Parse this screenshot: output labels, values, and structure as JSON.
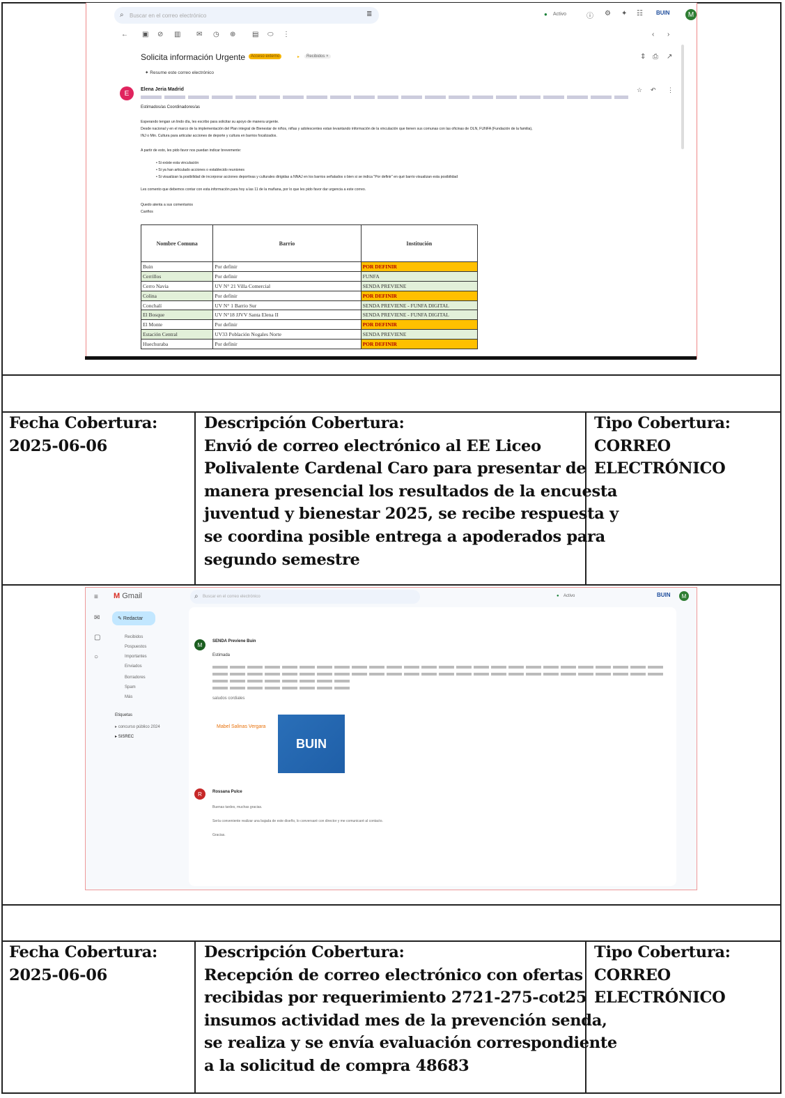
{
  "rows": [
    {
      "fecha_label": "Fecha Cobertura:",
      "fecha_value": "2025-06-06",
      "descripcion_label": "Descripción Cobertura:",
      "descripcion_lines": [
        "Envió de correo electrónico al EE Liceo",
        "Polivalente Cardenal Caro para presentar de",
        "manera presencial los resultados de la encuesta",
        "juventud y bienestar 2025, se recibe respuesta y",
        "se coordina posible entrega a apoderados para",
        "segundo semestre"
      ],
      "tipo_label": "Tipo Cobertura:",
      "tipo_lines": [
        "CORREO",
        "ELECTRÓNICO"
      ]
    },
    {
      "fecha_label": "Fecha Cobertura:",
      "fecha_value": "2025-06-06",
      "descripcion_label": "Descripción Cobertura:",
      "descripcion_lines": [
        "Recepción de correo electrónico con ofertas",
        "recibidas por requerimiento 2721-275-cot25",
        "insumos actividad mes de la prevención senda,",
        "se realiza y se envía evaluación correspondiente",
        "a la solicitud de compra 48683"
      ],
      "tipo_label": "Tipo Cobertura:",
      "tipo_lines": [
        "CORREO",
        "ELECTRÓNICO"
      ]
    }
  ],
  "screenshot1": {
    "search_placeholder": "Buscar en el correo electrónico",
    "status": "Activo",
    "brand": "BUIN",
    "avatar_letter": "M",
    "subject": "Solicita información Urgente",
    "label_badge": "Acceso externo",
    "label_inbox": "Recibidos ×",
    "summarize": "Resume este correo electrónico",
    "sender": "Elena Jeria Madrid",
    "sender_avatar": "E",
    "greeting": "Estimados/as Coordinadores/as",
    "body_lines": [
      "Esperando tengan un lindo día, les escribo para solicitar su apoyo de manera urgente.",
      "Desde nacional y en el marco de la implementación del Plan integral de Bienestar de niños, niñas y adolescentes estan levantando información de la vinculación que tienen sus comunas con las oficinas de OLN, FUNFA (Fundación de la familia),",
      "INJ o Min. Cultura para articular acciones de deporte y cultura en barrios focalizados."
    ],
    "intro_list": "A partir de esto, les pido favor nos puedan indicar brevemente:",
    "bullets": [
      "Si existe esta vinculación",
      "Si ya han articulado acciones o establecido reuniones",
      "Si visualizan la posibilidad de incorporar acciones deportivas y culturales dirigidas a NNAJ en los barrios señalados o bien si se indica \"Por definir\" en qué barrio visualizan esta posibilidad"
    ],
    "deadline": "Les comento que debemos contar con esta información para hoy a las 11 de la mañana, por lo que les pido favor dar urgencia a este correo.",
    "closing": "Quedo atenta a sus comentarios",
    "signoff": "Cariños",
    "table": {
      "headers": [
        "Nombre Comuna",
        "Barrio",
        "Institución"
      ],
      "rows": [
        [
          "Buin",
          "Por definir",
          "POR DEFINIR"
        ],
        [
          "Cerrillos",
          "Por definir",
          "FUNFA"
        ],
        [
          "Cerro Navia",
          "UV N° 21 Villa Comercial",
          "SENDA PREVIENE"
        ],
        [
          "Colina",
          "Por definir",
          "POR DEFINIR"
        ],
        [
          "Conchalí",
          "UV N° 1 Barrio Sur",
          "SENDA PREVIENE - FUNFA DIGITAL"
        ],
        [
          "El Bosque",
          "UV N°18 JJVV Santa Elena II",
          "SENDA PREVIENE - FUNFA DIGITAL"
        ],
        [
          "El Monte",
          "Por definir",
          "POR DEFINIR"
        ],
        [
          "Estación Central",
          "UV33 Población Nogales Norte",
          "SENDA PREVIENE"
        ],
        [
          "Huechuraba",
          "Por definir",
          "POR DEFINIR"
        ]
      ]
    }
  },
  "screenshot2": {
    "app_name": "Gmail",
    "compose": "Redactar",
    "search_placeholder": "Buscar en el correo electrónico",
    "status": "Activo",
    "brand": "BUIN",
    "avatar_letter": "M",
    "nav_items": [
      "Recibidos",
      "Pospuestos",
      "Importantes",
      "Enviados",
      "Borradores",
      "Spam",
      "Más"
    ],
    "labels_title": "Etiquetas",
    "labels": [
      "concurso público 2024",
      "SISREC"
    ],
    "sender1": "SENDA Previene Buin",
    "sender1_avatar": "M",
    "greeting1": "Estimada",
    "signature_name": "Mabel Salinas Vergara",
    "salutation": "saludos cordiales",
    "logo_text": "BUIN",
    "sender2": "Rossana Pulce",
    "sender2_avatar": "R",
    "reply_lines": [
      "Buenas tardes, muchas gracias.",
      "Sería conveniente realizar una bajada de este diseño, lo conversaré con director y me comunicaré al contacto.",
      "Gracias."
    ]
  }
}
